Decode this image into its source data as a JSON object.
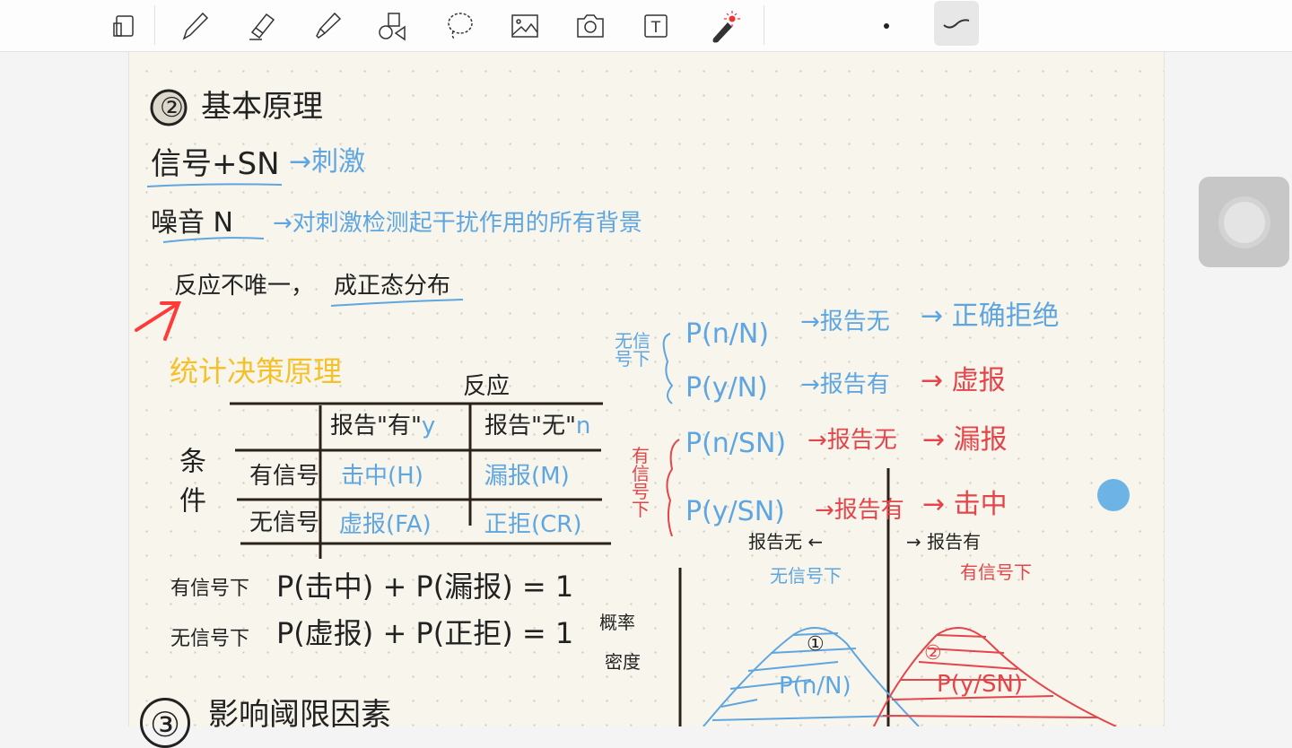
{
  "toolbar": {
    "tools": [
      "read-mode",
      "pen",
      "eraser",
      "highlighter",
      "shapes",
      "lasso",
      "image",
      "camera",
      "text",
      "laser-pointer"
    ],
    "text_tool_label": "T"
  },
  "colors": {
    "blue": "#5fa6e0",
    "red": "#e4454a",
    "yellow": "#f5c12a",
    "ink": "#222222",
    "paper": "#f8f6ec"
  },
  "note": {
    "section2_num": "②",
    "section2_title": "基本原理",
    "signal": "信号+SN",
    "signal_def": "→刺激",
    "noise": "噪音 N",
    "noise_def": "→对刺激检测起干扰作用的所有背景",
    "response_line": "反应不唯一，",
    "normal_dist": "成正态分布",
    "stat_title": "统计决策原理",
    "table": {
      "top_label": "反应",
      "side_label": "条件",
      "col_headers": [
        "报告\"有\"",
        "报告\"无\""
      ],
      "col_codes": [
        "y",
        "n"
      ],
      "rows": [
        {
          "label": "有信号",
          "cells": [
            "击中(H)",
            "漏报(M)"
          ]
        },
        {
          "label": "无信号",
          "cells": [
            "虚报(FA)",
            "正拒(CR)"
          ]
        }
      ]
    },
    "eq1_label": "有信号下",
    "eq1": "P(击中) + P(漏报) = 1",
    "eq2_label": "无信号下",
    "eq2": "P(虚报) + P(正拒) = 1",
    "section3_num": "③",
    "section3_title": "影响阈限因素",
    "no_signal_group": "无信号下",
    "signal_group": "有信号下",
    "cases": [
      {
        "p": "P(n/N)",
        "report": "→报告无",
        "result": "→ 正确拒绝"
      },
      {
        "p": "P(y/N)",
        "report": "→报告有",
        "result": "→ 虚报"
      },
      {
        "p": "P(n/SN)",
        "report": "→报告无",
        "result": "→ 漏报"
      },
      {
        "p": "P(y/SN)",
        "report": "→报告有",
        "result": "→ 击中"
      }
    ],
    "graph": {
      "left_label": "报告无 ←",
      "right_label": "→ 报告有",
      "left_sub": "无信号下",
      "right_sub": "有信号下",
      "y_label_1": "概率",
      "y_label_2": "密度",
      "curve1_num": "①",
      "curve1": "P(n/N)",
      "curve2_num": "②",
      "curve2": "P(y/SN)"
    }
  }
}
